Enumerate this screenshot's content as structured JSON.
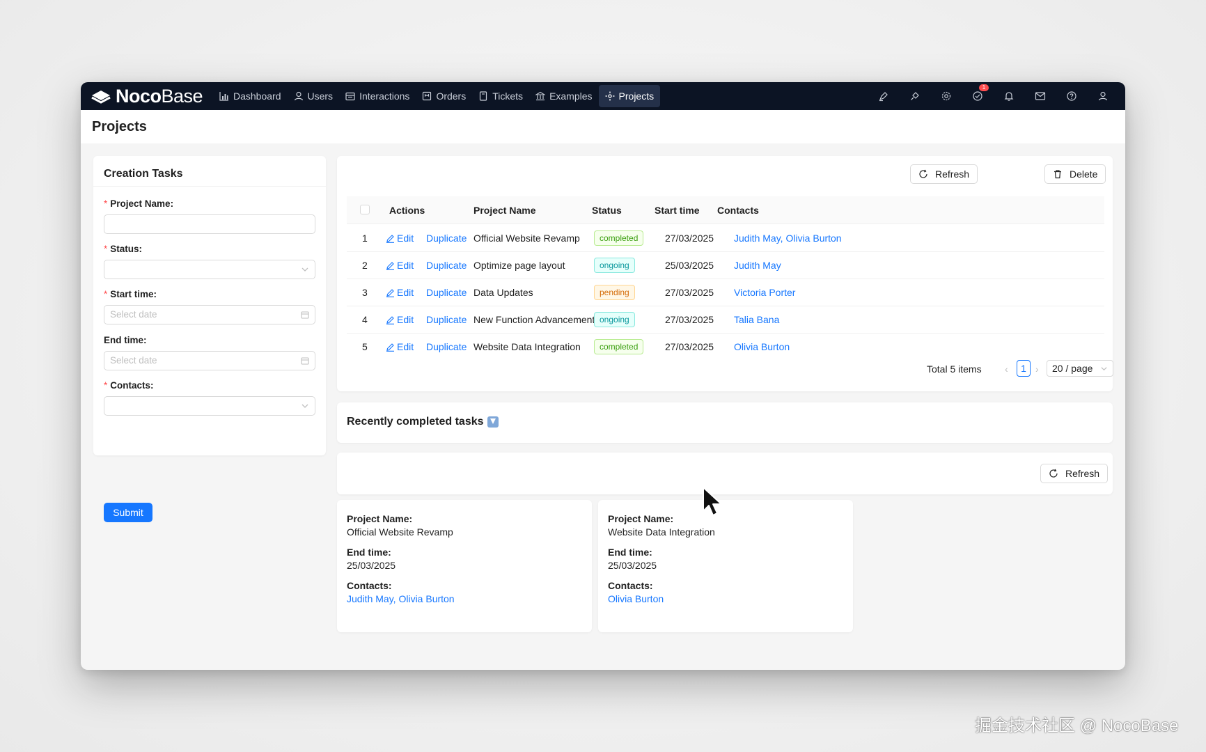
{
  "app": {
    "logo_bold": "Noco",
    "logo_light": "Base"
  },
  "nav": [
    {
      "label": "Dashboard",
      "icon": "bar-chart-icon"
    },
    {
      "label": "Users",
      "icon": "user-icon"
    },
    {
      "label": "Interactions",
      "icon": "calendar-icon"
    },
    {
      "label": "Orders",
      "icon": "order-icon"
    },
    {
      "label": "Tickets",
      "icon": "ticket-icon"
    },
    {
      "label": "Examples",
      "icon": "bank-icon"
    },
    {
      "label": "Projects",
      "icon": "compass-icon",
      "active": true
    }
  ],
  "toolbar": {
    "icons": [
      "highlighter-icon",
      "plugin-icon",
      "gear-icon",
      "task-check-icon",
      "bell-icon",
      "mail-icon",
      "help-icon",
      "user-icon"
    ],
    "task_badge": "1"
  },
  "page": {
    "title": "Projects"
  },
  "form": {
    "title": "Creation Tasks",
    "fields": {
      "project_name": {
        "label": "Project Name",
        "required": true,
        "value": ""
      },
      "status": {
        "label": "Status",
        "required": true,
        "value": ""
      },
      "start_time": {
        "label": "Start time",
        "required": true,
        "placeholder": "Select date"
      },
      "end_time": {
        "label": "End time",
        "required": false,
        "placeholder": "Select date"
      },
      "contacts": {
        "label": "Contacts",
        "required": true,
        "value": ""
      }
    },
    "submit_label": "Submit"
  },
  "table": {
    "refresh_label": "Refresh",
    "delete_label": "Delete",
    "columns": [
      "Actions",
      "Project Name",
      "Status",
      "Start time",
      "Contacts"
    ],
    "edit_label": "Edit",
    "duplicate_label": "Duplicate",
    "rows": [
      {
        "num": "1",
        "name": "Official Website Revamp",
        "status": "completed",
        "start": "27/03/2025",
        "contacts": [
          "Judith May",
          "Olivia Burton"
        ]
      },
      {
        "num": "2",
        "name": "Optimize page layout",
        "status": "ongoing",
        "start": "25/03/2025",
        "contacts": [
          "Judith May"
        ]
      },
      {
        "num": "3",
        "name": "Data Updates",
        "status": "pending",
        "start": "27/03/2025",
        "contacts": [
          "Victoria Porter"
        ]
      },
      {
        "num": "4",
        "name": "New Function Advancement",
        "status": "ongoing",
        "start": "27/03/2025",
        "contacts": [
          "Talia Bana"
        ]
      },
      {
        "num": "5",
        "name": "Website Data Integration",
        "status": "completed",
        "start": "27/03/2025",
        "contacts": [
          "Olivia Burton"
        ]
      }
    ],
    "pagination": {
      "total": "Total 5 items",
      "current_page": "1",
      "page_size": "20 / page"
    }
  },
  "recent": {
    "title": "Recently completed tasks",
    "refresh_label": "Refresh",
    "items": [
      {
        "name_label": "Project Name",
        "name": "Official Website Revamp",
        "end_label": "End time",
        "end": "25/03/2025",
        "contacts_label": "Contacts",
        "contacts": [
          "Judith May",
          "Olivia Burton"
        ]
      },
      {
        "name_label": "Project Name",
        "name": "Website Data Integration",
        "end_label": "End time",
        "end": "25/03/2025",
        "contacts_label": "Contacts",
        "contacts": [
          "Olivia Burton"
        ]
      }
    ]
  },
  "watermark": "掘金技术社区 @ NocoBase",
  "colors": {
    "nav_bg": "#0c1424",
    "primary": "#1677ff",
    "required": "#ff4d4f"
  }
}
